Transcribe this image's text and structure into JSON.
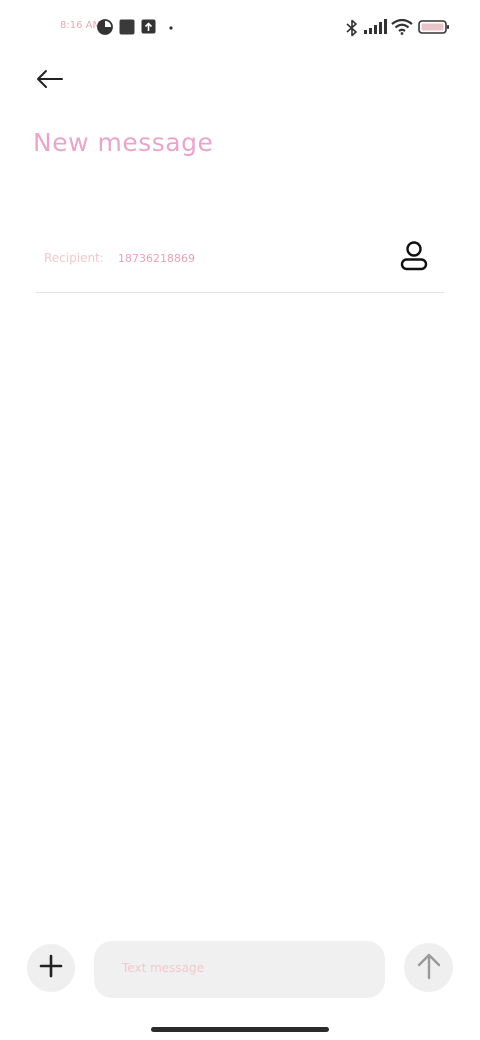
{
  "status_bar": {
    "time": "8:16 AM",
    "icons": [
      "data-saver-icon",
      "square-app-icon",
      "upload-icon",
      "dot-icon",
      "bluetooth-icon",
      "signal-icon",
      "wifi-icon",
      "battery-icon"
    ]
  },
  "header": {
    "back_icon": "back-arrow-icon",
    "title": "New message"
  },
  "recipient": {
    "label": "Recipient:",
    "value": "18736218869",
    "contact_icon": "contact-person-icon"
  },
  "composer": {
    "add_icon": "plus-icon",
    "placeholder": "Text message",
    "value": "",
    "send_icon": "send-arrow-up-icon"
  },
  "colors": {
    "background": "#ffffff",
    "title": "#e9a6cc",
    "label": "#f2c9cc",
    "recipient_value": "#e9a3b6",
    "button_bg": "#efefef",
    "compose_bg": "#f0f0f0",
    "icon_dark": "#222222",
    "send_icon": "#9a9a9a"
  }
}
